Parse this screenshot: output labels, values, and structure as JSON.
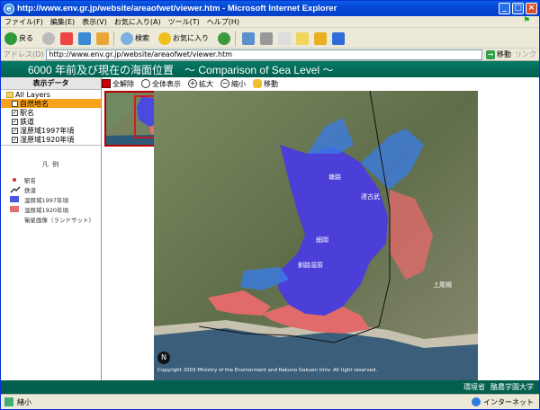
{
  "window": {
    "title": "http://www.env.gr.jp/website/areaofwet/viewer.htm - Microsoft Internet Explorer"
  },
  "menu": [
    "ファイル(F)",
    "編集(E)",
    "表示(V)",
    "お気に入り(A)",
    "ツール(T)",
    "ヘルプ(H)"
  ],
  "toolbar": {
    "back": "戻る",
    "search": "検索",
    "favorites": "お気に入り"
  },
  "address": {
    "label": "アドレス(D)",
    "url": "http://www.env.gr.jp/website/areaofwet/viewer.htm",
    "go": "移動",
    "links": "リンク"
  },
  "banner": {
    "title": "6000 年前及び現在の海面位置　～ Comparison of Sea Level ～"
  },
  "layers": {
    "header": "表示データ",
    "items": [
      {
        "label": "All Layers",
        "checked": true,
        "selected": false
      },
      {
        "label": "自然地名",
        "checked": false,
        "selected": true
      },
      {
        "label": "駅名",
        "checked": true,
        "selected": false
      },
      {
        "label": "鉄道",
        "checked": true,
        "selected": false
      },
      {
        "label": "湿原域1997年頃",
        "checked": true,
        "selected": false
      },
      {
        "label": "湿原域1920年頃",
        "checked": true,
        "selected": false
      }
    ]
  },
  "legend": {
    "header": "凡 例",
    "items": [
      {
        "label": "駅名",
        "color": "#c83232"
      },
      {
        "label": "鉄道",
        "color": "#222222"
      },
      {
        "label": "湿原域1997年頃",
        "color": "#4a58e0"
      },
      {
        "label": "湿原域1920年頃",
        "color": "#e07070"
      },
      {
        "label": "衛星画像（ランドサット）",
        "color": ""
      }
    ]
  },
  "maptools": {
    "clear": "全解除",
    "full": "全体表示",
    "zoomin": "拡大",
    "zoomout": "縮小",
    "pan": "移動"
  },
  "map": {
    "copyright": "Copyright 2003 Ministry of the Environment and Rakuno Gakuen Univ. All right reserved.",
    "north": "N",
    "labels": [
      "塘路",
      "細岡",
      "釧路湿原",
      "達古武",
      "上尾幌"
    ]
  },
  "footer": {
    "org1": "環境省",
    "org2": "酪農学園大学"
  },
  "status": {
    "text": "緒小",
    "zone": "インターネット"
  }
}
